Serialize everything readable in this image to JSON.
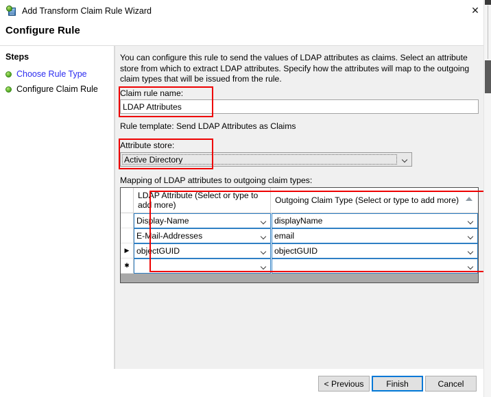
{
  "window": {
    "title": "Add Transform Claim Rule Wizard",
    "icon": "adfs-wizard-icon",
    "close_label": "✕"
  },
  "page": {
    "title": "Configure Rule"
  },
  "sidebar": {
    "heading": "Steps",
    "items": [
      {
        "label": "Choose Rule Type",
        "state": "link"
      },
      {
        "label": "Configure Claim Rule",
        "state": "current"
      }
    ]
  },
  "main": {
    "description": "You can configure this rule to send the values of LDAP attributes as claims. Select an attribute store from which to extract LDAP attributes. Specify how the attributes will map to the outgoing claim types that will be issued from the rule.",
    "claim_rule_name": {
      "label": "Claim rule name:",
      "value": "LDAP Attributes",
      "placeholder": ""
    },
    "rule_template": "Rule template: Send LDAP Attributes as Claims",
    "attribute_store": {
      "label": "Attribute store:",
      "value": "Active Directory"
    },
    "mapping_label": "Mapping of LDAP attributes to outgoing claim types:",
    "grid": {
      "columns": [
        "LDAP Attribute (Select or type to add more)",
        "Outgoing Claim Type (Select or type to add more)"
      ],
      "sort_indicator": "ascending",
      "rows": [
        {
          "marker": "",
          "ldap_attribute": "Display-Name",
          "outgoing_claim_type": "displayName"
        },
        {
          "marker": "",
          "ldap_attribute": "E-Mail-Addresses",
          "outgoing_claim_type": "email"
        },
        {
          "marker": "▶",
          "ldap_attribute": "objectGUID",
          "outgoing_claim_type": "objectGUID"
        },
        {
          "marker": "✱",
          "ldap_attribute": "",
          "outgoing_claim_type": ""
        }
      ]
    }
  },
  "footer": {
    "previous_label": "< Previous",
    "finish_label": "Finish",
    "cancel_label": "Cancel"
  },
  "colors": {
    "annotation": "#ee0000",
    "default_button_border": "#0078d7",
    "step_link": "#2d2df0",
    "cell_border": "#2e7fc4"
  }
}
